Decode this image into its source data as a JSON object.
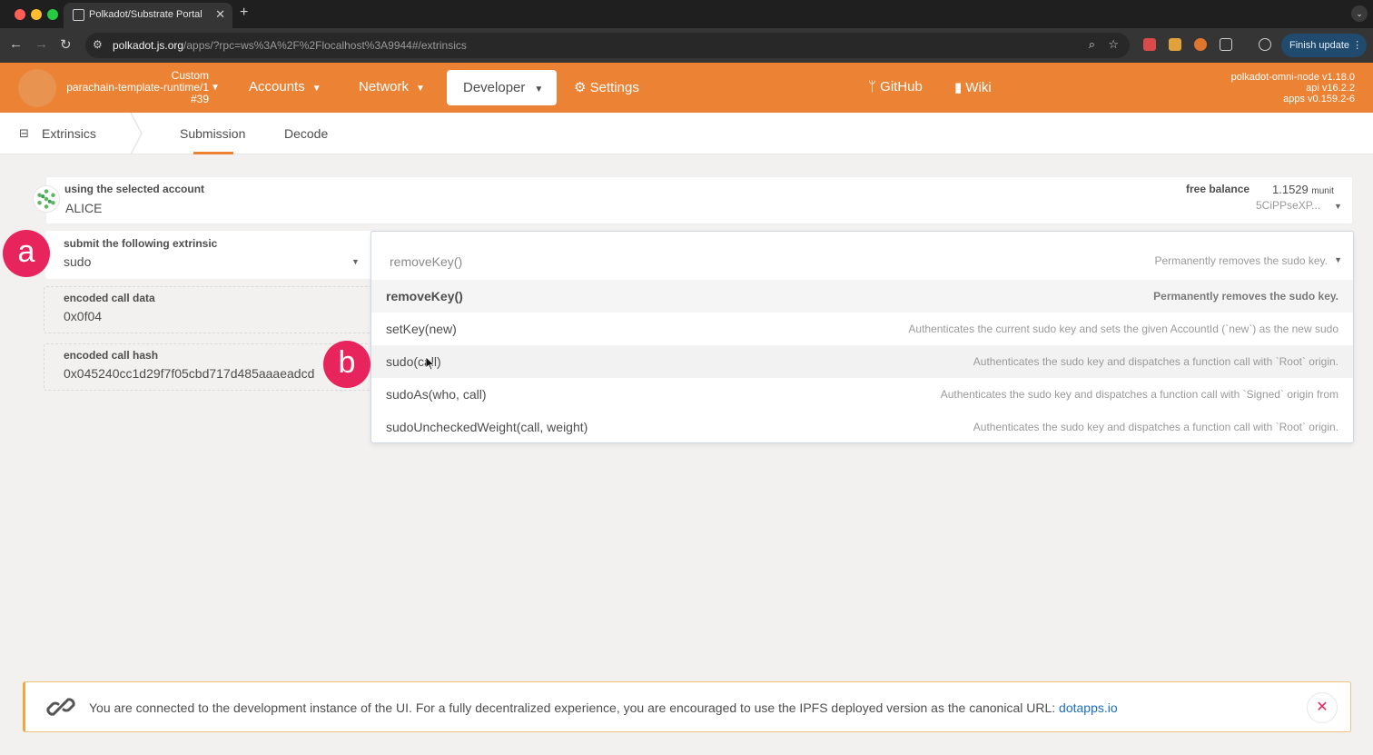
{
  "browser": {
    "tab_title": "Polkadot/Substrate Portal",
    "url_host": "polkadot.js.org",
    "url_rest": "/apps/?rpc=ws%3A%2F%2Flocalhost%3A9944#/extrinsics",
    "finish_update": "Finish update",
    "traffic_colors": [
      "#ff5f57",
      "#febc2e",
      "#28c840"
    ]
  },
  "header": {
    "chain_type": "Custom",
    "chain_name": "parachain-template-runtime/1",
    "chain_block": "#39",
    "menu": {
      "accounts": "Accounts",
      "network": "Network",
      "developer": "Developer",
      "settings": "Settings",
      "github": "GitHub",
      "wiki": "Wiki"
    },
    "versions": [
      "polkadot-omni-node v1.18.0",
      "api v16.2.2",
      "apps v0.159.2-6"
    ],
    "accent_color": "#ec8234"
  },
  "subnav": {
    "section": "Extrinsics",
    "tabs": [
      "Submission",
      "Decode"
    ],
    "active_tab": "Submission"
  },
  "account": {
    "label": "using the selected account",
    "name": "ALICE",
    "balance_label": "free balance",
    "balance_value": "1.1529",
    "balance_unit": "munit",
    "address": "5CiPPseXP..."
  },
  "extrinsic": {
    "label": "submit the following extrinsic",
    "module": "sudo",
    "encoded_call_data_label": "encoded call data",
    "encoded_call_data": "0x0f04",
    "encoded_call_hash_label": "encoded call hash",
    "encoded_call_hash": "0x045240cc1d29f7f05cbd717d485aaaeadcd"
  },
  "badges": {
    "a": "a",
    "b": "b",
    "color": "#e8245d"
  },
  "dropdown": {
    "selected": "removeKey()",
    "selected_desc": "Permanently removes the sudo key.",
    "options": [
      {
        "name": "removeKey()",
        "desc": "Permanently removes the sudo key."
      },
      {
        "name": "setKey(new)",
        "desc": "Authenticates the current sudo key and sets the given AccountId (`new`) as the new sudo"
      },
      {
        "name": "sudo(call)",
        "desc": "Authenticates the sudo key and dispatches a function call with `Root` origin."
      },
      {
        "name": "sudoAs(who, call)",
        "desc": "Authenticates the sudo key and dispatches a function call with `Signed` origin from"
      },
      {
        "name": "sudoUncheckedWeight(call, weight)",
        "desc": "Authenticates the sudo key and dispatches a function call with `Root` origin."
      }
    ]
  },
  "notice": {
    "text": "You are connected to the development instance of the UI. For a fully decentralized experience, you are encouraged to use the IPFS deployed version as the canonical URL:",
    "link": "dotapps.io"
  }
}
